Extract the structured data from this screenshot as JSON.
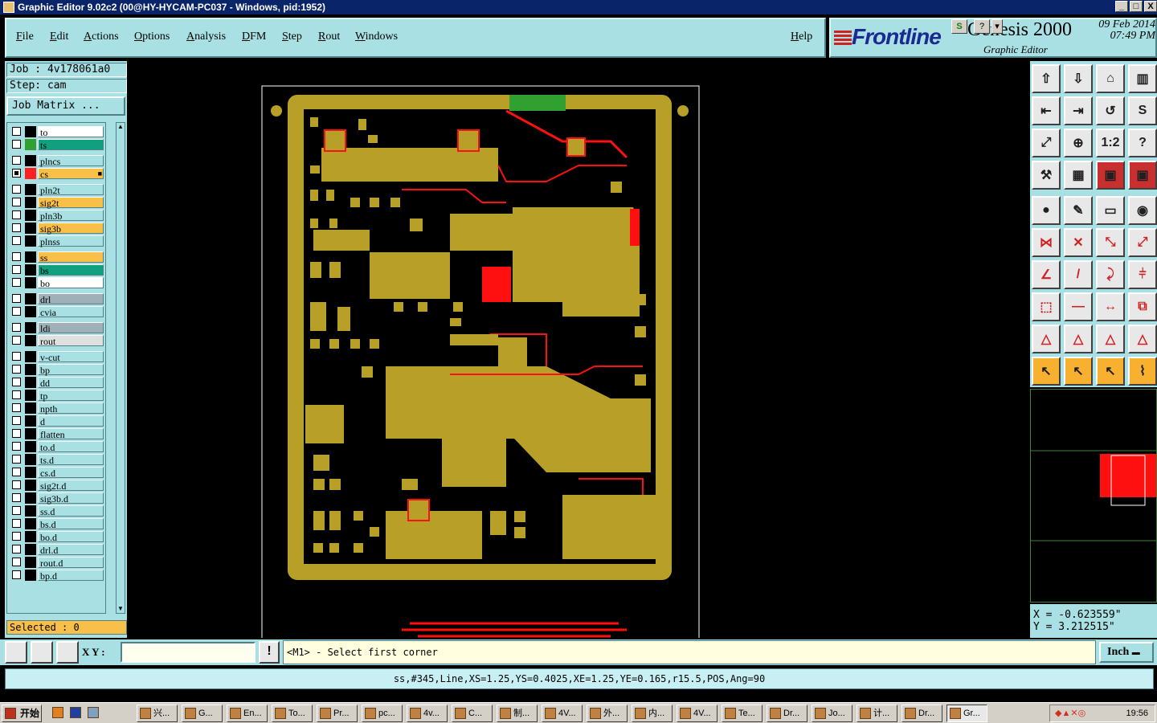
{
  "window": {
    "title": "Graphic Editor 9.02c2 (00@HY-HYCAM-PC037 - Windows, pid:1952)",
    "controls": [
      "_",
      "□",
      "X"
    ]
  },
  "menu": {
    "items": [
      "File",
      "Edit",
      "Actions",
      "Options",
      "Analysis",
      "DFM",
      "Step",
      "Rout",
      "Windows"
    ],
    "help": "Help"
  },
  "branding": {
    "logo": "Frontline",
    "product": "Genesis 2000",
    "subtitle": "Graphic Editor",
    "date": "09 Feb 2014",
    "time": "07:49 PM"
  },
  "job": {
    "job_label": "Job  : 4v178061a0",
    "step_label": "Step: cam",
    "matrix_button": "Job Matrix ..."
  },
  "layers": [
    {
      "name": "to",
      "swatch": "#000000",
      "bg": "#ffffff",
      "checked": false
    },
    {
      "name": "ts",
      "swatch": "#30a030",
      "bg": "#10a080",
      "checked": false
    },
    {
      "name": "plncs",
      "swatch": "#000000",
      "bg": "#a8e0e4",
      "checked": false
    },
    {
      "name": "cs",
      "swatch": "#ff2020",
      "bg": "#f8c048",
      "checked": true,
      "marker": "■"
    },
    {
      "name": "pln2t",
      "swatch": "#000000",
      "bg": "#a8e0e4",
      "checked": false
    },
    {
      "name": "sig2t",
      "swatch": "#000000",
      "bg": "#f8c048",
      "checked": false
    },
    {
      "name": "pln3b",
      "swatch": "#000000",
      "bg": "#a8e0e4",
      "checked": false
    },
    {
      "name": "sig3b",
      "swatch": "#000000",
      "bg": "#f8c048",
      "checked": false
    },
    {
      "name": "plnss",
      "swatch": "#000000",
      "bg": "#a8e0e4",
      "checked": false
    },
    {
      "name": "ss",
      "swatch": "#000000",
      "bg": "#f8c048",
      "checked": false
    },
    {
      "name": "bs",
      "swatch": "#000000",
      "bg": "#10a080",
      "checked": false
    },
    {
      "name": "bo",
      "swatch": "#000000",
      "bg": "#ffffff",
      "checked": false
    },
    {
      "name": "drl",
      "swatch": "#000000",
      "bg": "#a0b0b8",
      "checked": false
    },
    {
      "name": "cvia",
      "swatch": "#000000",
      "bg": "#a8e0e4",
      "checked": false
    },
    {
      "name": "ldi",
      "swatch": "#000000",
      "bg": "#a0b0b8",
      "checked": false
    },
    {
      "name": "rout",
      "swatch": "#000000",
      "bg": "#e0e0e0",
      "checked": false
    },
    {
      "name": "v-cut",
      "swatch": "#000000",
      "bg": "#a8e0e4",
      "checked": false
    },
    {
      "name": "bp",
      "swatch": "#000000",
      "bg": "#a8e0e4",
      "checked": false
    },
    {
      "name": "dd",
      "swatch": "#000000",
      "bg": "#a8e0e4",
      "checked": false
    },
    {
      "name": "tp",
      "swatch": "#000000",
      "bg": "#a8e0e4",
      "checked": false
    },
    {
      "name": "npth",
      "swatch": "#000000",
      "bg": "#a8e0e4",
      "checked": false
    },
    {
      "name": "d",
      "swatch": "#000000",
      "bg": "#a8e0e4",
      "checked": false
    },
    {
      "name": "flatten",
      "swatch": "#000000",
      "bg": "#a8e0e4",
      "checked": false
    },
    {
      "name": "to.d",
      "swatch": "#000000",
      "bg": "#a8e0e4",
      "checked": false
    },
    {
      "name": "ts.d",
      "swatch": "#000000",
      "bg": "#a8e0e4",
      "checked": false
    },
    {
      "name": "cs.d",
      "swatch": "#000000",
      "bg": "#a8e0e4",
      "checked": false
    },
    {
      "name": "sig2t.d",
      "swatch": "#000000",
      "bg": "#a8e0e4",
      "checked": false
    },
    {
      "name": "sig3b.d",
      "swatch": "#000000",
      "bg": "#a8e0e4",
      "checked": false
    },
    {
      "name": "ss.d",
      "swatch": "#000000",
      "bg": "#a8e0e4",
      "checked": false
    },
    {
      "name": "bs.d",
      "swatch": "#000000",
      "bg": "#a8e0e4",
      "checked": false
    },
    {
      "name": "bo.d",
      "swatch": "#000000",
      "bg": "#a8e0e4",
      "checked": false
    },
    {
      "name": "drl.d",
      "swatch": "#000000",
      "bg": "#a8e0e4",
      "checked": false
    },
    {
      "name": "rout.d",
      "swatch": "#000000",
      "bg": "#a8e0e4",
      "checked": false
    },
    {
      "name": "bp.d",
      "swatch": "#000000",
      "bg": "#a8e0e4",
      "checked": false
    }
  ],
  "selected_label": "Selected : 0",
  "coords": {
    "x": "X = -0.623559\"",
    "y": "Y = 3.212515\""
  },
  "command": {
    "xy_label": "X Y :",
    "xy_value": "",
    "prompt": "<M1> - Select first corner",
    "unit": "Inch"
  },
  "status": "ss,#345,Line,XS=1.25,YS=0.4025,XE=1.25,YE=0.165,r15.5,POS,Ang=90",
  "colors": {
    "accent": "#a8e0e4",
    "copper": "#b8a028",
    "trace": "#ff1010",
    "board_bg": "#000000",
    "highlight": "#f8c048"
  },
  "tools": {
    "rows": [
      [
        "upload-icon",
        "download-icon",
        "home-icon",
        "panel-icon"
      ],
      [
        "move-left-icon",
        "move-right-icon",
        "undo-icon",
        "snake-icon"
      ],
      [
        "zoom-fit-icon",
        "zoom-icon",
        "scale-icon",
        "help-icon"
      ],
      [
        "measure-icon",
        "grid-icon",
        "layer-red-icon",
        "layer-red2-icon"
      ],
      [
        "pad-icon",
        "edit-icon",
        "ruler-icon",
        "circle-icon"
      ],
      [
        "network-icon",
        "delete-icon",
        "connect-icon",
        "connect2-icon"
      ],
      [
        "angle-icon",
        "line-icon",
        "arc-icon",
        "ff-icon"
      ],
      [
        "move-pad-icon",
        "minus-icon",
        "measure2-icon",
        "copy-icon"
      ],
      [
        "triangle-icon",
        "triangle2-icon",
        "triangle3-icon",
        "triangle4-icon"
      ],
      [
        "pointer-icon",
        "pointer2-icon",
        "pointer3-icon",
        "route-icon"
      ]
    ]
  },
  "taskbar": {
    "start": "开始",
    "items": [
      "兴...",
      "G...",
      "En...",
      "To...",
      "Pr...",
      "pc...",
      "4v...",
      "C...",
      "制...",
      "4V...",
      "外...",
      "内...",
      "4V...",
      "Te...",
      "Dr...",
      "Jo...",
      "计...",
      "Dr...",
      "Gr..."
    ],
    "clock": "19:56"
  }
}
